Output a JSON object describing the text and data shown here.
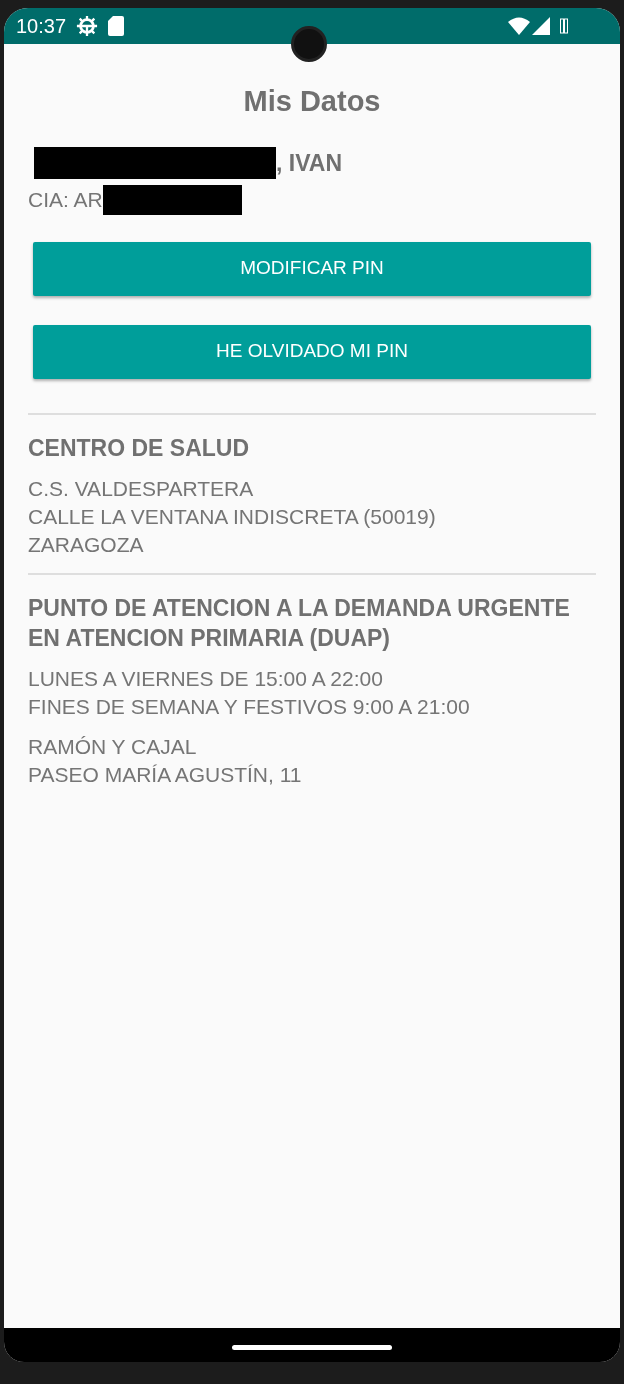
{
  "status_bar": {
    "time": "10:37"
  },
  "title": "Mis Datos",
  "user": {
    "name": ", IVAN",
    "cia": "CIA: AR"
  },
  "buttons": [
    "MODIFICAR PIN",
    "HE OLVIDADO MI PIN"
  ],
  "sections": [
    {
      "heading": "CENTRO DE SALUD",
      "paragraphs": [
        [
          "C.S. VALDESPARTERA",
          "CALLE LA VENTANA INDISCRETA (50019)",
          "ZARAGOZA"
        ]
      ]
    },
    {
      "heading": "PUNTO DE ATENCION A LA DEMANDA URGENTE EN ATENCION PRIMARIA (DUAP)",
      "paragraphs": [
        [
          "LUNES A VIERNES DE 15:00 A 22:00",
          "FINES DE SEMANA Y FESTIVOS 9:00 A 21:00"
        ],
        [
          "RAMÓN Y CAJAL",
          "PASEO MARÍA AGUSTÍN, 11"
        ]
      ]
    }
  ]
}
